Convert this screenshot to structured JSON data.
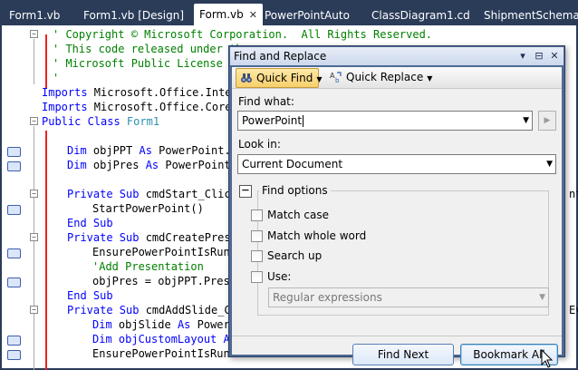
{
  "tabs": [
    {
      "label": "Form1.vb"
    },
    {
      "label": "Form1.vb [Design]"
    },
    {
      "label": "Form.vb",
      "active": true
    },
    {
      "label": "PowerPointAuto"
    },
    {
      "label": "ClassDiagram1.cd"
    },
    {
      "label": "ShipmentSchema.x"
    }
  ],
  "code": {
    "lines": [
      "' Copyright © Microsoft Corporation.  All Rights Reserved.",
      "' This code released under the",
      "' Microsoft Public License (MS",
      "'",
      "Imports Microsoft.Office.Inter",
      "Imports Microsoft.Office.Core",
      "Public Class Form1",
      "Dim objPPT As PowerPoint.A",
      "Dim objPres As PowerPoint.",
      "Private Sub cmdStart_Click",
      "StartPowerPoint()",
      "End Sub",
      "Private Sub cmdCreatePrese",
      "EnsurePowerPointIsRunn",
      "'Add Presentation",
      "objPres = objPPT.Prese",
      "End Sub",
      "Private Sub cmdAddSlide_Cl",
      "Dim objSlide As PowerP",
      "Dim objCustomLayout As",
      "EnsurePowerPointIsRunn"
    ],
    "trail_nt": "nt",
    "trail_ev": "Ev"
  },
  "dialog": {
    "title": "Find and Replace",
    "controls": {
      "dropdown": "▾",
      "pin": "⊟",
      "close": "✕"
    },
    "toolbar": {
      "quick_find": "Quick Find",
      "quick_replace": "Quick Replace"
    },
    "find_what_label": "Find what:",
    "find_what_value": "PowerPoint",
    "look_in_label": "Look in:",
    "look_in_value": "Current Document",
    "find_options_label": "Find options",
    "options": {
      "match_case": "Match case",
      "match_whole_word": "Match whole word",
      "search_up": "Search up",
      "use": "Use:"
    },
    "use_value": "Regular expressions",
    "buttons": {
      "find_next": "Find Next",
      "bookmark_all": "Bookmark All"
    }
  },
  "colors": {
    "tab_strip": "#2b3c59",
    "keyword": "#0000ff",
    "comment": "#008000",
    "type": "#2b91af",
    "dialog_frame": "#4e6a95"
  }
}
